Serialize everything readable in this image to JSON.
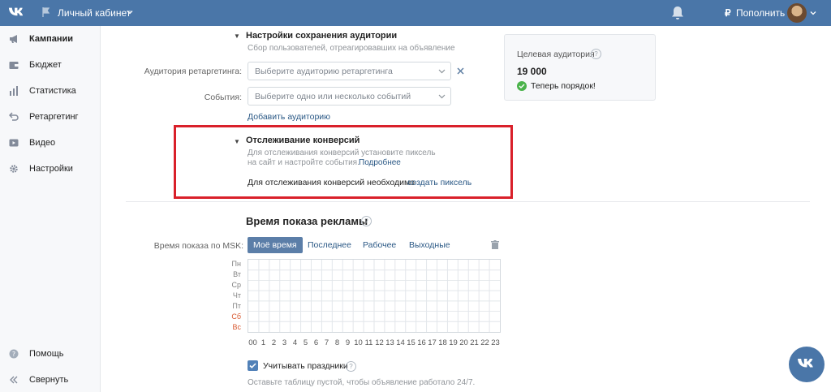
{
  "topbar": {
    "cabinet_label": "Личный кабинет",
    "rub_sign": "₽",
    "topup_label": "Пополнить"
  },
  "sidebar": {
    "items": [
      {
        "label": "Кампании",
        "icon": "megaphone-icon"
      },
      {
        "label": "Бюджет",
        "icon": "wallet-icon"
      },
      {
        "label": "Статистика",
        "icon": "bar-chart-icon"
      },
      {
        "label": "Ретаргетинг",
        "icon": "retarget-arrow-icon"
      },
      {
        "label": "Видео",
        "icon": "video-play-icon"
      },
      {
        "label": "Настройки",
        "icon": "gear-icon"
      }
    ],
    "help_label": "Помощь",
    "collapse_label": "Свернуть"
  },
  "audience_save": {
    "title": "Настройки сохранения аудитории",
    "subtitle": "Сбор пользователей, отреагировавших на объявление",
    "retarget_label": "Аудитория ретаргетинга:",
    "retarget_placeholder": "Выберите аудиторию ретаргетинга",
    "events_label": "События:",
    "events_placeholder": "Выберите одно или несколько событий",
    "add_audience_link": "Добавить аудиторию"
  },
  "conversion": {
    "title": "Отслеживание конверсий",
    "desc_line1": "Для отслеживания конверсий установите пиксель",
    "desc_line2": "на сайт и настройте события.",
    "more_link": "Подробнее",
    "need_text": "Для отслеживания конверсий необходимо",
    "create_pixel_link": "создать пиксель"
  },
  "target_card": {
    "label": "Целевая аудитория",
    "value": "19 000",
    "status": "Теперь порядок!"
  },
  "schedule": {
    "title": "Время показа рекламы",
    "row_label": "Время показа по MSK:",
    "presets": [
      "Моё время",
      "Последнее",
      "Рабочее",
      "Выходные"
    ],
    "days": [
      "Пн",
      "Вт",
      "Ср",
      "Чт",
      "Пт",
      "Сб",
      "Вс"
    ],
    "hours": [
      "00",
      "1",
      "2",
      "3",
      "4",
      "5",
      "6",
      "7",
      "8",
      "9",
      "10",
      "11",
      "12",
      "13",
      "14",
      "15",
      "16",
      "17",
      "18",
      "19",
      "20",
      "21",
      "22",
      "23"
    ],
    "holidays_label": "Учитывать праздники",
    "hint": "Оставьте таблицу пустой, чтобы объявление работало 24/7."
  },
  "colors": {
    "header": "#4a76a8",
    "link": "#2a5885",
    "highlight_box": "#d9202a",
    "weekend": "#d85a32"
  }
}
